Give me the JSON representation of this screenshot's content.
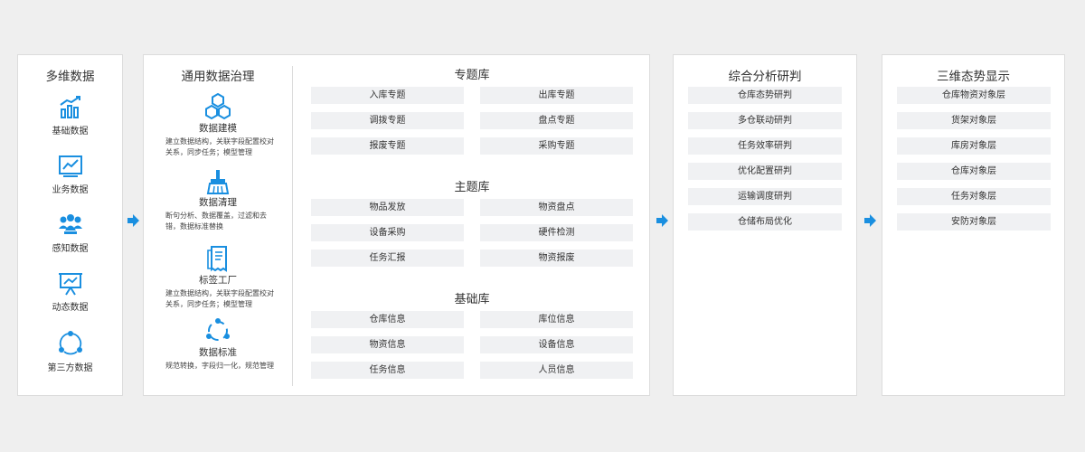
{
  "multi_data": {
    "title": "多维数据",
    "items": [
      {
        "label": "基础数据",
        "icon": "bar-chart-icon"
      },
      {
        "label": "业务数据",
        "icon": "line-chart-icon"
      },
      {
        "label": "感知数据",
        "icon": "people-icon"
      },
      {
        "label": "动态数据",
        "icon": "presentation-icon"
      },
      {
        "label": "第三方数据",
        "icon": "share-network-icon"
      }
    ]
  },
  "governance": {
    "title": "通用数据治理",
    "items": [
      {
        "label": "数据建模",
        "icon": "hexagons-icon",
        "desc": "建立数据结构，关联字段配置校对关系，同步任务；模型管理"
      },
      {
        "label": "数据清理",
        "icon": "brush-icon",
        "desc": "断句分析、数据覆盖，过滤和去错，数据标准替换"
      },
      {
        "label": "标签工厂",
        "icon": "receipt-icon",
        "desc": "建立数据结构，关联字段配置校对关系，同步任务；模型管理"
      },
      {
        "label": "数据标准",
        "icon": "cycle-icon",
        "desc": "规范转换，字段归一化，规范管理"
      }
    ],
    "topic_lib": {
      "title": "专题库",
      "items": [
        "入库专题",
        "出库专题",
        "调拨专题",
        "盘点专题",
        "报废专题",
        "采购专题"
      ]
    },
    "subject_lib": {
      "title": "主题库",
      "items": [
        "物品发放",
        "物资盘点",
        "设备采购",
        "硬件检测",
        "任务汇报",
        "物资报废"
      ]
    },
    "base_lib": {
      "title": "基础库",
      "items": [
        "仓库信息",
        "库位信息",
        "物资信息",
        "设备信息",
        "任务信息",
        "人员信息"
      ]
    }
  },
  "analysis": {
    "title": "综合分析研判",
    "items": [
      "仓库态势研判",
      "多仓联动研判",
      "任务效率研判",
      "优化配置研判",
      "运输调度研判",
      "仓储布局优化"
    ]
  },
  "display": {
    "title": "三维态势显示",
    "items": [
      "仓库物资对象层",
      "货架对象层",
      "库房对象层",
      "仓库对象层",
      "任务对象层",
      "安防对象层"
    ]
  },
  "colors": {
    "accent": "#1a8fe0",
    "chip_bg": "#f0f1f3",
    "panel_border": "#dcdcdc",
    "background": "#efefef"
  }
}
